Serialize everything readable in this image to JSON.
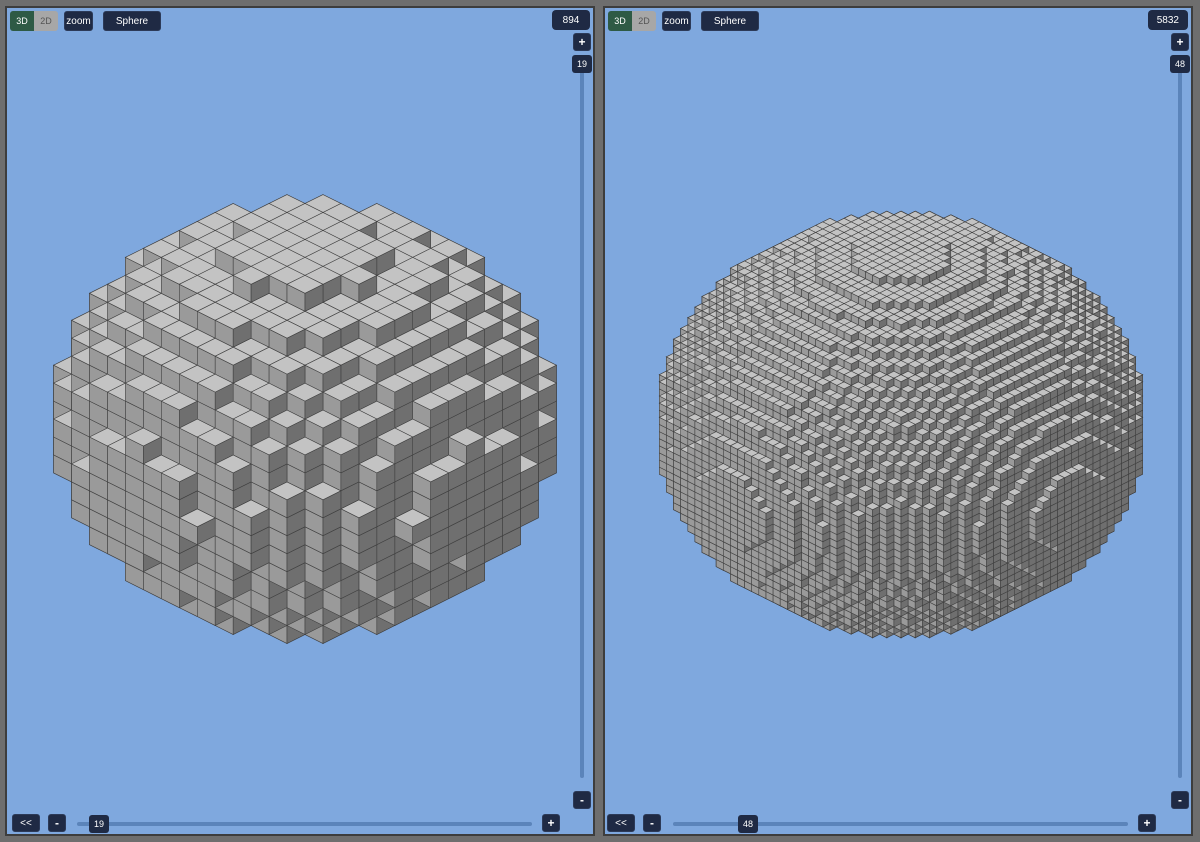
{
  "panels": [
    {
      "id": "left",
      "mode_toggle": {
        "option_3d": "3D",
        "option_2d": "2D",
        "active": "3D"
      },
      "zoom_label": "zoom",
      "shape_label": "Sphere",
      "voxel_count": "894",
      "vertical_slider": {
        "plus_label": "+",
        "minus_label": "-",
        "value_label": "19"
      },
      "horizontal_slider": {
        "back_label": "<<",
        "minus_label": "-",
        "plus_label": "+",
        "value_label": "19"
      },
      "sphere_resolution": 19
    },
    {
      "id": "right",
      "mode_toggle": {
        "option_3d": "3D",
        "option_2d": "2D",
        "active": "3D"
      },
      "zoom_label": "zoom",
      "shape_label": "Sphere",
      "voxel_count": "5832",
      "vertical_slider": {
        "plus_label": "+",
        "minus_label": "-",
        "value_label": "48"
      },
      "horizontal_slider": {
        "back_label": "<<",
        "minus_label": "-",
        "plus_label": "+",
        "value_label": "48"
      },
      "sphere_resolution": 48
    }
  ],
  "colors": {
    "viewport_bg": "#7fa8de",
    "button_bg": "#1f2a44",
    "toggle_active": "#2e5a45",
    "toggle_inactive": "#a7a7a7",
    "cube_top": "#c3c3c3",
    "cube_left": "#9a9a9a",
    "cube_right": "#6f6f6f",
    "cube_edge": "#3f3f3f"
  }
}
